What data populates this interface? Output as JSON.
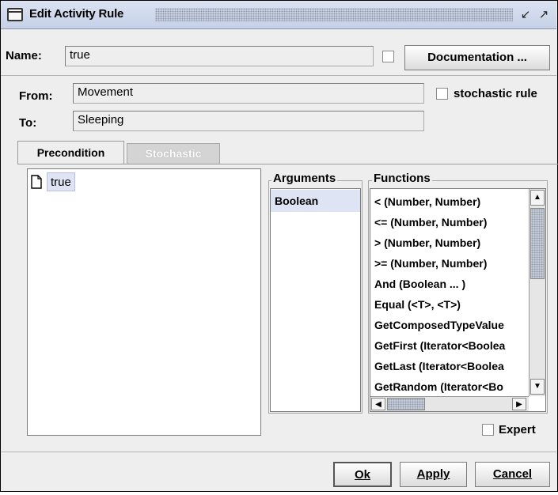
{
  "window": {
    "title": "Edit Activity Rule",
    "icon": "window-icon",
    "controls": [
      "minimize-icon",
      "maximize-icon"
    ]
  },
  "name": {
    "label": "Name:",
    "value": "true",
    "documentation_button": "Documentation ..."
  },
  "from": {
    "label": "From:",
    "value": "Movement"
  },
  "to": {
    "label": "To:",
    "value": "Sleeping"
  },
  "stochastic_rule": {
    "label": "stochastic rule",
    "checked": false
  },
  "tabs": [
    {
      "label": "Precondition",
      "active": true
    },
    {
      "label": "Stochastic",
      "active": false
    }
  ],
  "tree": {
    "items": [
      {
        "icon": "document-icon",
        "label": "true"
      }
    ]
  },
  "arguments": {
    "title": "Arguments",
    "items": [
      "Boolean"
    ]
  },
  "functions": {
    "title": "Functions",
    "items": [
      "< (Number, Number)",
      "<= (Number, Number)",
      "> (Number, Number)",
      ">= (Number, Number)",
      "And (Boolean ... )",
      "Equal (<T>, <T>)",
      "GetComposedTypeValue",
      "GetFirst (Iterator<Boolea",
      "GetLast (Iterator<Boolea",
      "GetRandom (Iterator<Bo"
    ]
  },
  "expert": {
    "label": "Expert",
    "checked": false
  },
  "buttons": {
    "ok": "Ok",
    "apply": "Apply",
    "cancel": "Cancel"
  }
}
